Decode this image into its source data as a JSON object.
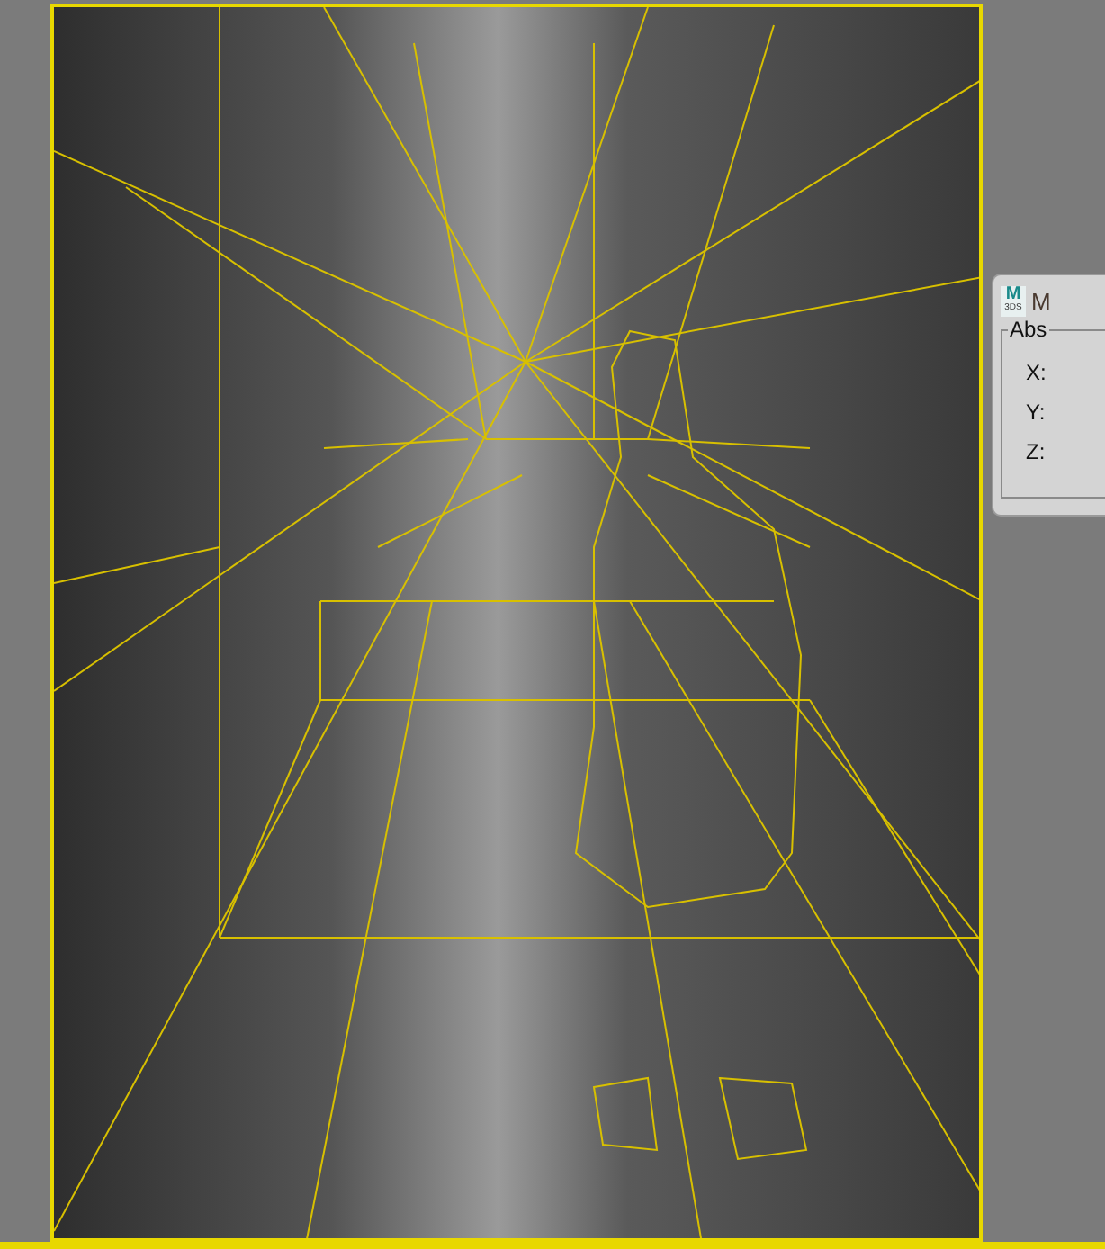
{
  "dialog": {
    "logo_mark": "M",
    "logo_sub": "3DS",
    "title": "M",
    "group": "Abs",
    "axes": [
      "X:",
      "Y:",
      "Z:"
    ]
  }
}
